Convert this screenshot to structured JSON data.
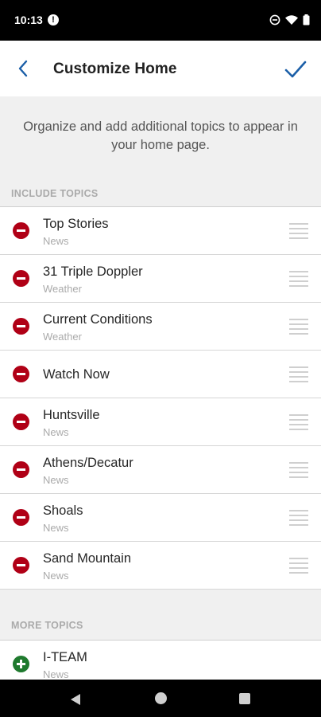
{
  "status_bar": {
    "time": "10:13",
    "info_glyph": "!"
  },
  "header": {
    "title": "Customize Home",
    "back_icon": "chevron-left-icon",
    "done_icon": "checkmark-icon",
    "accent_color": "#1b5fa8"
  },
  "intro": {
    "text": "Organize and add additional topics to appear in your home page."
  },
  "include_section": {
    "label": "INCLUDE TOPICS",
    "items": [
      {
        "title": "Top Stories",
        "category": "News"
      },
      {
        "title": "31 Triple Doppler",
        "category": "Weather"
      },
      {
        "title": "Current Conditions",
        "category": "Weather"
      },
      {
        "title": "Watch Now",
        "category": ""
      },
      {
        "title": "Huntsville",
        "category": "News"
      },
      {
        "title": "Athens/Decatur",
        "category": "News"
      },
      {
        "title": "Shoals",
        "category": "News"
      },
      {
        "title": "Sand Mountain",
        "category": "News"
      }
    ]
  },
  "more_section": {
    "label": "MORE TOPICS",
    "items": [
      {
        "title": "I-TEAM",
        "category": "News"
      }
    ]
  },
  "colors": {
    "remove": "#b00016",
    "add": "#1f7a2e"
  }
}
